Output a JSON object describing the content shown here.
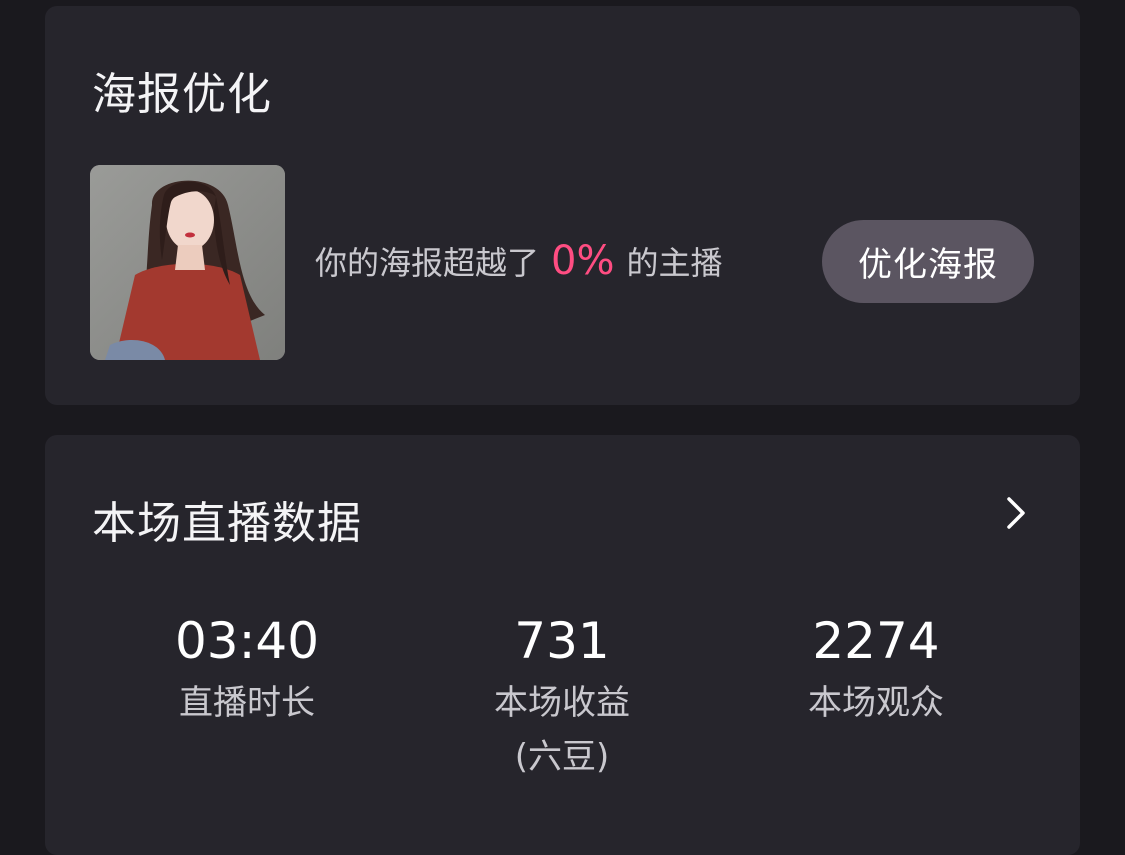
{
  "poster": {
    "title": "海报优化",
    "rank_prefix": "你的海报超越了",
    "rank_percent": "0%",
    "rank_suffix": "的主播",
    "button_label": "优化海报",
    "colors": {
      "accent": "#ff4d82",
      "card": "#26252c",
      "button": "#5b5561"
    }
  },
  "live_stats": {
    "title": "本场直播数据",
    "items": [
      {
        "value": "03:40",
        "label": "直播时长",
        "sub": ""
      },
      {
        "value": "731",
        "label": "本场收益",
        "sub": "(六豆)"
      },
      {
        "value": "2274",
        "label": "本场观众",
        "sub": ""
      }
    ]
  }
}
